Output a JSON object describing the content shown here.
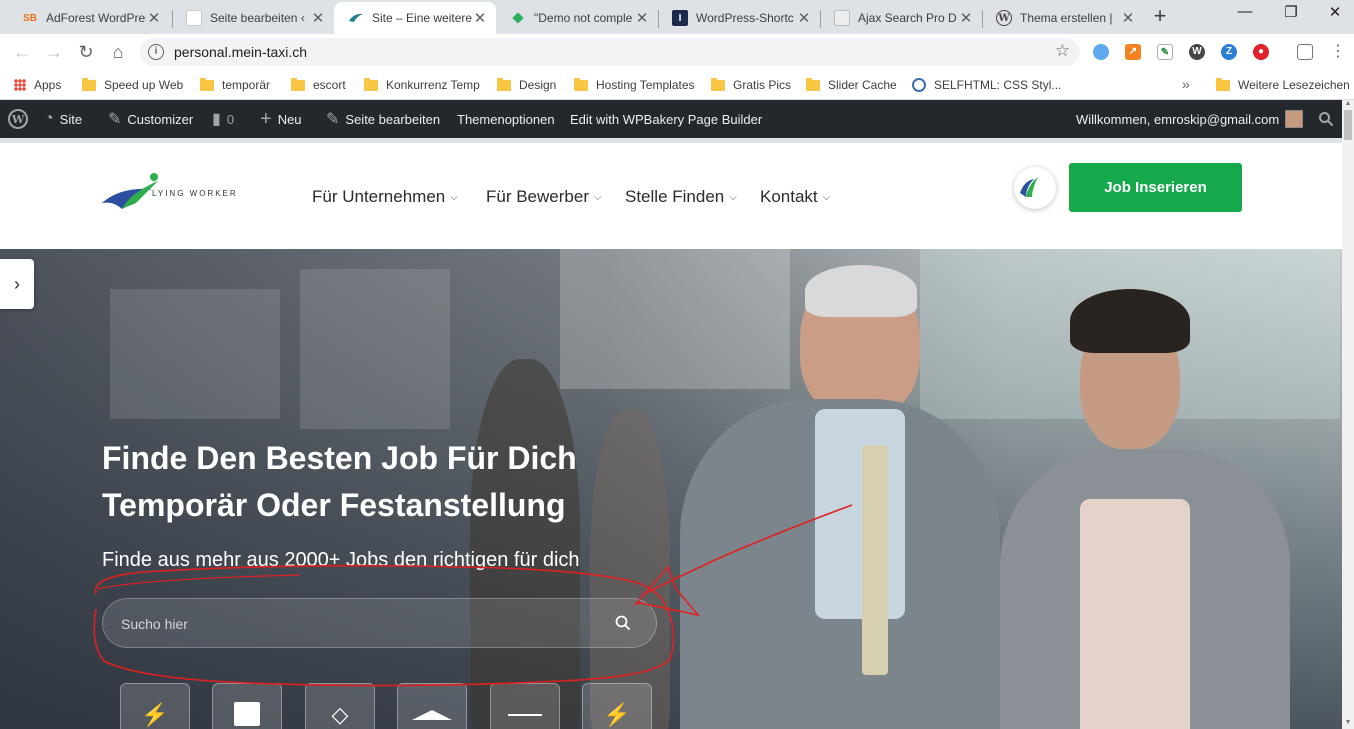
{
  "browser": {
    "tabs": [
      {
        "title": "AdForest WordPress",
        "icon": "sb-icon"
      },
      {
        "title": "Seite bearbeiten ‹",
        "icon": "blank-icon"
      },
      {
        "title": "Site – Eine weitere",
        "icon": "site-icon"
      },
      {
        "title": "\"Demo not comple",
        "icon": "diamond-icon"
      },
      {
        "title": "WordPress-Shortc",
        "icon": "i-icon"
      },
      {
        "title": "Ajax Search Pro D",
        "icon": "doc-icon"
      },
      {
        "title": "Thema erstellen | ",
        "icon": "wordpress-icon"
      }
    ],
    "new_tab": "+",
    "window_controls": {
      "minimize": "—",
      "restore": "❐",
      "close": "✕"
    },
    "url": "personal.mein-taxi.ch",
    "bookmarks": [
      "Apps",
      "Speed up Web",
      "temporär",
      "escort",
      "Konkurrenz Temp",
      "Design",
      "Hosting Templates",
      "Gratis Pics",
      "Slider Cache",
      "SELFHTML: CSS Styl...",
      "Weitere Lesezeichen"
    ],
    "bookmarks_overflow": "»"
  },
  "adminbar": {
    "site": "Site",
    "customizer": "Customizer",
    "comments_count": "0",
    "new": "Neu",
    "edit_page": "Seite bearbeiten",
    "theme_options": "Themenoptionen",
    "wpbakery": "Edit with WPBakery Page Builder",
    "welcome": "Willkommen, emroskip@gmail.com"
  },
  "header": {
    "logo_text": "LYING WORKER",
    "nav": [
      {
        "label": "Für Unternehmen"
      },
      {
        "label": "Für Bewerber"
      },
      {
        "label": "Stelle Finden"
      },
      {
        "label": "Kontakt"
      }
    ],
    "cta": "Job Inserieren"
  },
  "hero": {
    "title_line1": "Finde Den Besten Job Für Dich",
    "title_line2": "Temporär Oder Festanstellung",
    "subtitle": "Finde aus mehr aus 2000+ Jobs den richtigen für dich",
    "search_placeholder": "Sucho hier",
    "categories": [
      {
        "icon": "lightning-icon"
      },
      {
        "icon": "chip-icon"
      },
      {
        "icon": "layers-icon"
      },
      {
        "icon": "triangle-icon"
      },
      {
        "icon": "line-icon"
      },
      {
        "icon": "lightning-icon"
      }
    ]
  },
  "colors": {
    "accent_green": "#15a94c",
    "adminbar": "#23282d",
    "annotation_red": "#e02020"
  }
}
